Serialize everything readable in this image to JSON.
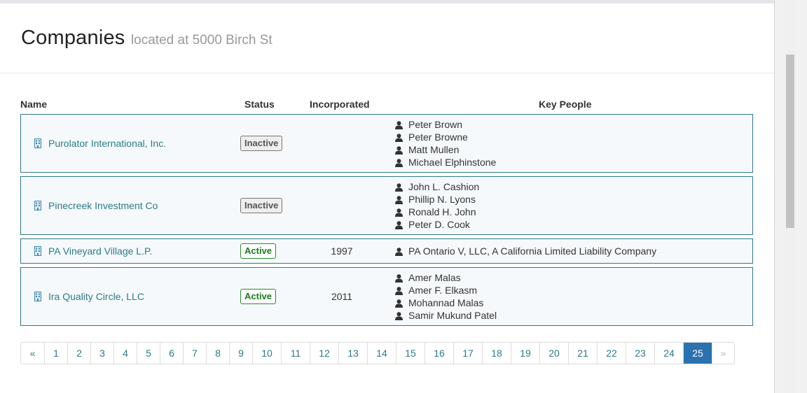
{
  "header": {
    "title": "Companies",
    "subtitle": "located at 5000 Birch St"
  },
  "columns": {
    "name": "Name",
    "status": "Status",
    "incorporated": "Incorporated",
    "key_people": "Key People"
  },
  "companies": [
    {
      "name": "Purolator International, Inc.",
      "status": "Inactive",
      "incorporated": "",
      "people": [
        "Peter Brown",
        "Peter Browne",
        "Matt Mullen",
        "Michael Elphinstone"
      ]
    },
    {
      "name": "Pinecreek Investment Co",
      "status": "Inactive",
      "incorporated": "",
      "people": [
        "John L. Cashion",
        "Phillip N. Lyons",
        "Ronald H. John",
        "Peter D. Cook"
      ]
    },
    {
      "name": "PA Vineyard Village L.P.",
      "status": "Active",
      "incorporated": "1997",
      "people": [
        "PA Ontario V, LLC, A California Limited Liability Company"
      ]
    },
    {
      "name": "Ira Quality Circle, LLC",
      "status": "Active",
      "incorporated": "2011",
      "people": [
        "Amer Malas",
        "Amer F. Elkasm",
        "Mohannad Malas",
        "Samir Mukund Patel"
      ]
    }
  ],
  "pagination": {
    "prev": "«",
    "next": "»",
    "pages": [
      "1",
      "2",
      "3",
      "4",
      "5",
      "6",
      "7",
      "8",
      "9",
      "10",
      "11",
      "12",
      "13",
      "14",
      "15",
      "16",
      "17",
      "18",
      "19",
      "20",
      "21",
      "22",
      "23",
      "24",
      "25"
    ],
    "current": "25"
  },
  "icons": {
    "company": "building-icon",
    "person": "user-icon"
  },
  "colors": {
    "link": "#2b7a8a",
    "row_border": "#2f7a84",
    "active_badge": "#2a8a2a",
    "current_page": "#2a72b0"
  }
}
